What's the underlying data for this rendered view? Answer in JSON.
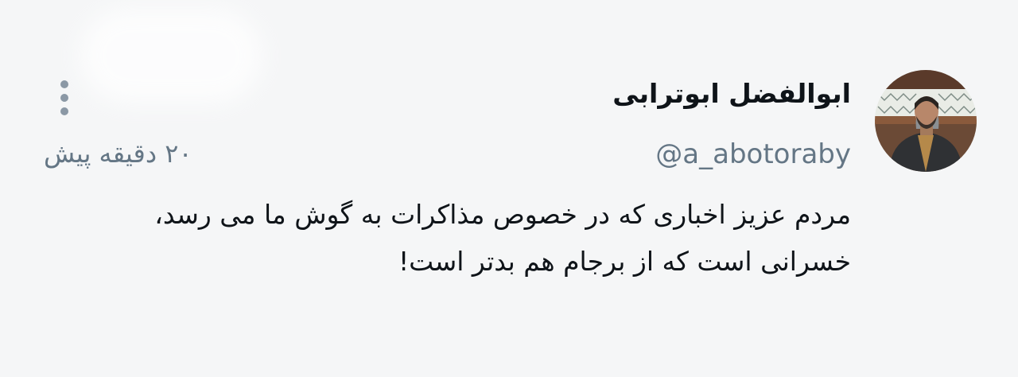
{
  "tweet": {
    "author_name": "ابوالفضل ابوترابی",
    "handle": "@a_abotoraby",
    "timestamp": "۲۰ دقیقه پیش",
    "text": "مردم عزیز اخباری که در خصوص مذاکرات به گوش ما می رسد، خسرانی است که از برجام هم بدتر است!"
  },
  "icons": {
    "more": "more-vertical-icon",
    "avatar": "profile-photo"
  },
  "colors": {
    "background": "#f5f6f7",
    "text_primary": "#0f1419",
    "text_secondary": "#647685"
  }
}
